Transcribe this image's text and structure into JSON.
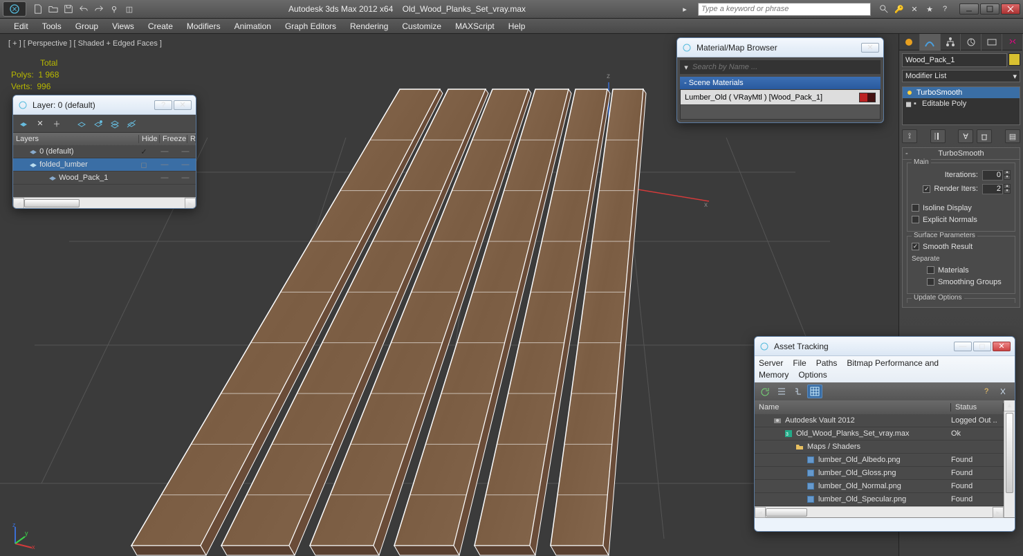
{
  "app": {
    "title": "Autodesk 3ds Max  2012 x64",
    "document": "Old_Wood_Planks_Set_vray.max",
    "search_placeholder": "Type a keyword or phrase"
  },
  "menu": [
    "Edit",
    "Tools",
    "Group",
    "Views",
    "Create",
    "Modifiers",
    "Animation",
    "Graph Editors",
    "Rendering",
    "Customize",
    "MAXScript",
    "Help"
  ],
  "viewport": {
    "label": "[ + ]  [ Perspective ]  [ Shaded + Edged Faces ]",
    "stats_total": "Total",
    "stats_polys_label": "Polys:",
    "stats_polys_value": "1 968",
    "stats_verts_label": "Verts:",
    "stats_verts_value": "996"
  },
  "layer_window": {
    "title": "Layer: 0 (default)",
    "cols": {
      "layers": "Layers",
      "hide": "Hide",
      "freeze": "Freeze",
      "r": "R"
    },
    "rows": [
      {
        "name": "0 (default)",
        "indent": 16,
        "selected": false,
        "check": true
      },
      {
        "name": "folded_lumber",
        "indent": 16,
        "selected": true,
        "box": true
      },
      {
        "name": "Wood_Pack_1",
        "indent": 44,
        "selected": false
      }
    ]
  },
  "material_browser": {
    "title": "Material/Map Browser",
    "search_placeholder": "Search by Name ...",
    "section": "-  Scene Materials",
    "item": "Lumber_Old  ( VRayMtl )  [Wood_Pack_1]"
  },
  "asset_tracking": {
    "title": "Asset Tracking",
    "menu": [
      "Server",
      "File",
      "Paths",
      "Bitmap Performance and Memory",
      "Options"
    ],
    "cols": {
      "name": "Name",
      "status": "Status"
    },
    "rows": [
      {
        "icon": "vault",
        "indent": 20,
        "name": "Autodesk Vault 2012",
        "status": "Logged Out .."
      },
      {
        "icon": "max",
        "indent": 36,
        "name": "Old_Wood_Planks_Set_vray.max",
        "status": "Ok"
      },
      {
        "icon": "folder",
        "indent": 52,
        "name": "Maps / Shaders",
        "status": ""
      },
      {
        "icon": "img",
        "indent": 68,
        "name": "lumber_Old_Albedo.png",
        "status": "Found"
      },
      {
        "icon": "img",
        "indent": 68,
        "name": "lumber_Old_Gloss.png",
        "status": "Found"
      },
      {
        "icon": "img",
        "indent": 68,
        "name": "lumber_Old_Normal.png",
        "status": "Found"
      },
      {
        "icon": "img",
        "indent": 68,
        "name": "lumber_Old_Specular.png",
        "status": "Found"
      }
    ]
  },
  "right_panel": {
    "object_name": "Wood_Pack_1",
    "modifier_list_label": "Modifier List",
    "stack": [
      {
        "name": "TurboSmooth",
        "selected": true,
        "bulb": true
      },
      {
        "name": "Editable Poly",
        "selected": false,
        "expandable": true
      }
    ],
    "rollout_title": "TurboSmooth",
    "main_legend": "Main",
    "iterations_label": "Iterations:",
    "iterations_value": "0",
    "render_iters_label": "Render Iters:",
    "render_iters_value": "2",
    "render_iters_checked": true,
    "isoline_label": "Isoline Display",
    "explicit_label": "Explicit Normals",
    "surface_legend": "Surface Parameters",
    "smooth_result_label": "Smooth Result",
    "smooth_result_checked": true,
    "separate_label": "Separate",
    "materials_label": "Materials",
    "smoothing_groups_label": "Smoothing Groups",
    "update_legend": "Update Options"
  }
}
